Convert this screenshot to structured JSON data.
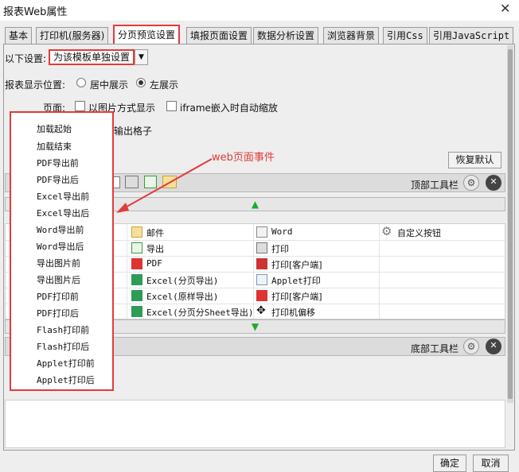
{
  "window": {
    "title": "报表Web属性",
    "close": "✕"
  },
  "tabs": [
    "基本",
    "打印机(服务器)",
    "分页预览设置",
    "填报页面设置",
    "数据分析设置",
    "浏览器背景",
    "引用Css",
    "引用JavaScript"
  ],
  "settings": {
    "label": "以下设置:",
    "mode_value": "为该模板单独设置"
  },
  "position": {
    "label": "报表显示位置:",
    "options": [
      "居中展示",
      "左展示"
    ],
    "selected": "左展示"
  },
  "page": {
    "label": "页面:",
    "checkbox_image": "以图片方式显示",
    "checkbox_iframe": "iframe嵌入时自动缩放"
  },
  "output_cell": "输出格子",
  "restore_button": "恢复默认",
  "top_toolbar": {
    "label": "顶部工具栏"
  },
  "bottom_toolbar": {
    "label": "底部工具栏"
  },
  "annotation": "web页面事件",
  "grid_buttons": [
    [
      "邮件",
      "Word",
      "自定义按钮"
    ],
    [
      "导出",
      "打印",
      ""
    ],
    [
      "PDF",
      "打印[客户端]",
      ""
    ],
    [
      "Excel(分页导出)",
      "Applet打印",
      ""
    ],
    [
      "Excel(原样导出)",
      "打印[客户端]",
      ""
    ],
    [
      "Excel(分页分Sheet导出)",
      "打印机偏移",
      ""
    ]
  ],
  "events": [
    "加载起始",
    "加载结束",
    "PDF导出前",
    "PDF导出后",
    "Excel导出前",
    "Excel导出后",
    "Word导出前",
    "Word导出后",
    "导出图片前",
    "导出图片后",
    "PDF打印前",
    "PDF打印后",
    "Flash打印前",
    "Flash打印后",
    "Applet打印前",
    "Applet打印后"
  ],
  "dialog": {
    "ok": "确定",
    "cancel": "取消"
  },
  "colors": {
    "highlight": "#e23b3b",
    "arrow_green": "#1eaa2c"
  }
}
